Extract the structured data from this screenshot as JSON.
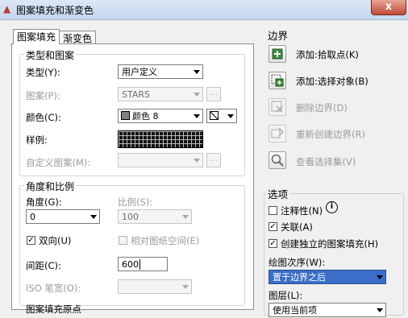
{
  "window": {
    "title": "图案填充和渐变色",
    "close_glyph": "x"
  },
  "tabs": [
    {
      "label": "图案填充",
      "active": true
    },
    {
      "label": "渐变色",
      "active": false
    }
  ],
  "type_pattern": {
    "legend": "类型和图案",
    "type_label": "类型(Y):",
    "type_value": "用户定义",
    "pattern_label": "图案(P):",
    "pattern_value": "STARS",
    "color_label": "颜色(C):",
    "color_value": "颜色 8",
    "color_swatch": "#808080",
    "swatch_label": "样例:",
    "custom_label": "自定义图案(M):",
    "ellipsis": "..."
  },
  "angle_scale": {
    "legend": "角度和比例",
    "angle_label": "角度(G):",
    "angle_value": "0",
    "scale_label": "比例(S):",
    "scale_value": "100",
    "double_label": "双向(U)",
    "double_checked": true,
    "relative_label": "相对图纸空间(E)",
    "spacing_label": "间距(C):",
    "spacing_value": "600",
    "iso_label": "ISO 笔宽(O):",
    "next_section_label": "图案填充原点"
  },
  "boundaries": {
    "legend": "边界",
    "add_pick_label": "添加:拾取点(K)",
    "add_select_label": "添加:选择对象(B)",
    "remove_label": "删除边界(D)",
    "recreate_label": "重新创建边界(R)",
    "view_label": "查看选择集(V)"
  },
  "options": {
    "legend": "选项",
    "annotative_label": "注释性(N)",
    "info_glyph": "i",
    "associative_label": "关联(A)",
    "associative_checked": true,
    "separate_label": "创建独立的图案填充(H)",
    "separate_checked": true,
    "draw_order_label": "绘图次序(W):",
    "draw_order_value": "置于边界之后",
    "layer_label": "图层(L):",
    "layer_value": "使用当前项"
  }
}
